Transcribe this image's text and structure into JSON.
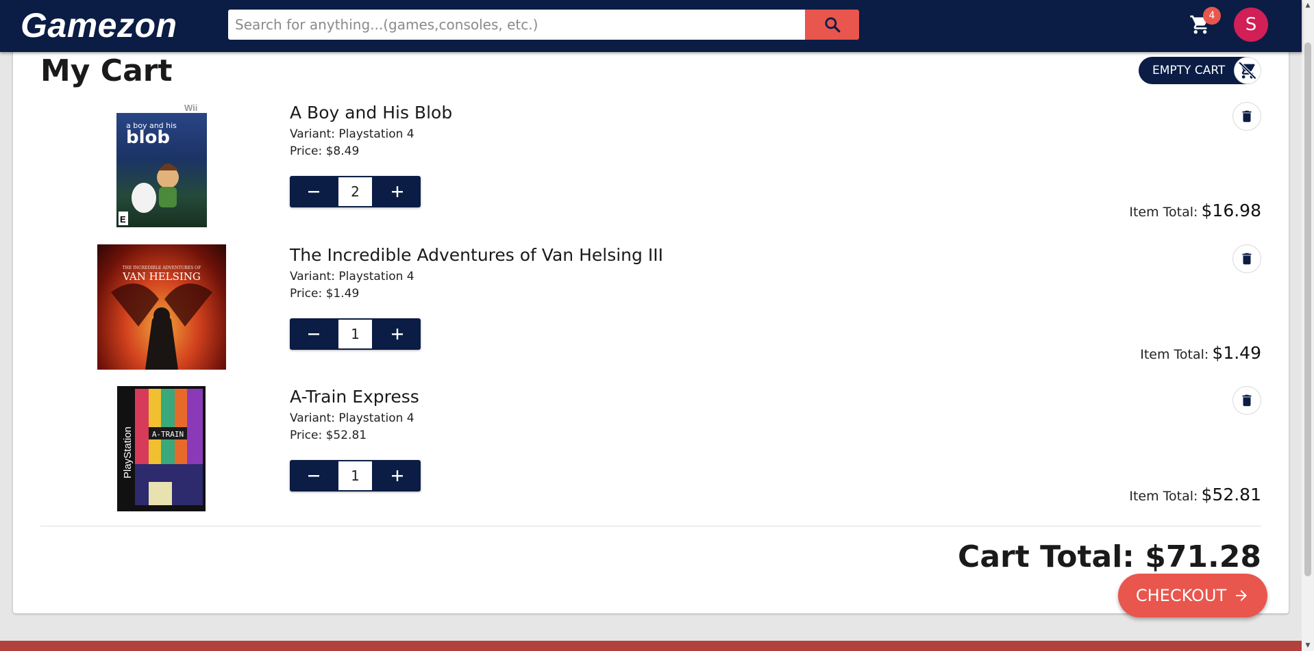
{
  "header": {
    "logo": "Gamezon",
    "search_placeholder": "Search for anything...(games,consoles, etc.)",
    "cart_count": "4",
    "avatar_initial": "S"
  },
  "page": {
    "title": "My Cart",
    "empty_cart_label": "EMPTY CART"
  },
  "items": [
    {
      "title": "A Boy and His Blob",
      "variant": "Variant: Playstation 4",
      "price": "Price: $8.49",
      "quantity": "2",
      "total_label": "Item Total:",
      "total": "$16.98"
    },
    {
      "title": "The Incredible Adventures of Van Helsing III",
      "variant": "Variant: Playstation 4",
      "price": "Price: $1.49",
      "quantity": "1",
      "total_label": "Item Total:",
      "total": "$1.49"
    },
    {
      "title": "A-Train Express",
      "variant": "Variant: Playstation 4",
      "price": "Price: $52.81",
      "quantity": "1",
      "total_label": "Item Total:",
      "total": "$52.81"
    }
  ],
  "cover_text": {
    "blob_platform": "Wii",
    "blob_caption": "a boy and his",
    "blob_word": "blob",
    "blob_rating": "E",
    "vh_small": "THE INCREDIBLE ADVENTURES OF",
    "vh_title": "VAN HELSING",
    "atrain_platform": "PlayStation",
    "atrain_title": "A-TRAIN"
  },
  "summary": {
    "cart_total": "Cart Total: $71.28",
    "checkout_label": "CHECKOUT"
  },
  "icons": {
    "search": "search-icon",
    "cart": "shopping-cart-icon",
    "remove_cart": "remove-shopping-cart-icon",
    "delete": "trash-icon",
    "minus": "minus-icon",
    "plus": "plus-icon",
    "arrow": "arrow-right-icon"
  },
  "colors": {
    "navy": "#0b1d45",
    "accent": "#e8564d",
    "avatar": "#d21f57"
  }
}
